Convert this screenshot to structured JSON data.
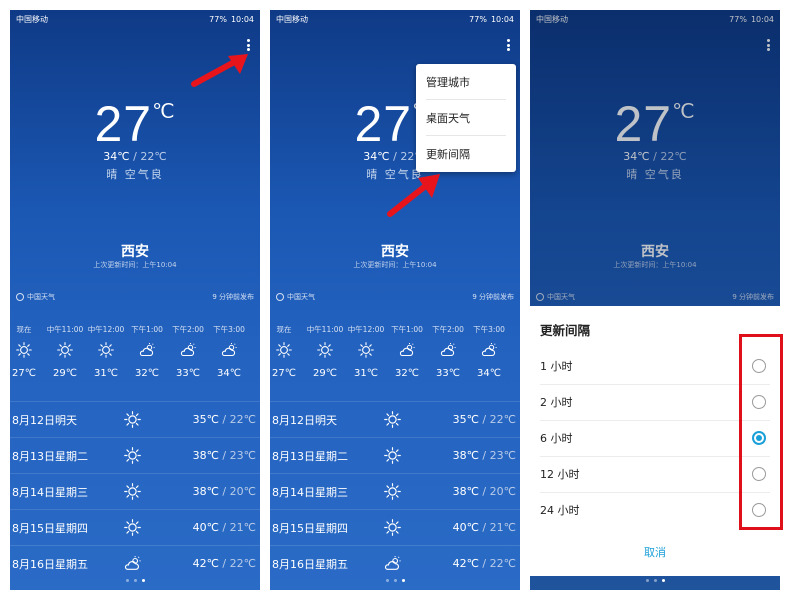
{
  "status": {
    "carrier": "中国移动",
    "battery": "77%",
    "time": "10:04"
  },
  "weather": {
    "temp": "27",
    "unit": "℃",
    "high": "34℃",
    "sep": " / ",
    "low": "22℃",
    "condition": "晴 空气良",
    "city": "西安",
    "updated": "上次更新时间：上午10:04",
    "source": "中国天气",
    "published": "9 分钟前发布"
  },
  "hourly": [
    {
      "time": "现在",
      "icon": "sun-icon",
      "temp": "27℃"
    },
    {
      "time": "中午11:00",
      "icon": "sun-icon",
      "temp": "29℃"
    },
    {
      "time": "中午12:00",
      "icon": "sun-icon",
      "temp": "31℃"
    },
    {
      "time": "下午1:00",
      "icon": "sun-cloud-icon",
      "temp": "32℃"
    },
    {
      "time": "下午2:00",
      "icon": "sun-cloud-icon",
      "temp": "33℃"
    },
    {
      "time": "下午3:00",
      "icon": "sun-cloud-icon",
      "temp": "34℃"
    }
  ],
  "daily": [
    {
      "day": "8月12日明天",
      "icon": "sun-icon",
      "high": "35℃",
      "low": "22℃"
    },
    {
      "day": "8月13日星期二",
      "icon": "sun-icon",
      "high": "38℃",
      "low": "23℃"
    },
    {
      "day": "8月14日星期三",
      "icon": "sun-icon",
      "high": "38℃",
      "low": "20℃"
    },
    {
      "day": "8月15日星期四",
      "icon": "sun-icon",
      "high": "40℃",
      "low": "21℃"
    },
    {
      "day": "8月16日星期五",
      "icon": "sun-cloud-icon",
      "high": "42℃",
      "low": "22℃"
    }
  ],
  "menu": {
    "items": [
      "管理城市",
      "桌面天气",
      "更新间隔"
    ]
  },
  "dialog": {
    "title": "更新间隔",
    "options": [
      "1 小时",
      "2 小时",
      "6 小时",
      "12 小时",
      "24 小时"
    ],
    "selected_index": 2,
    "cancel": "取消"
  },
  "colors": {
    "accent": "#1aa0d8",
    "highlight": "#e0101a",
    "arrow": "#e8141c"
  }
}
